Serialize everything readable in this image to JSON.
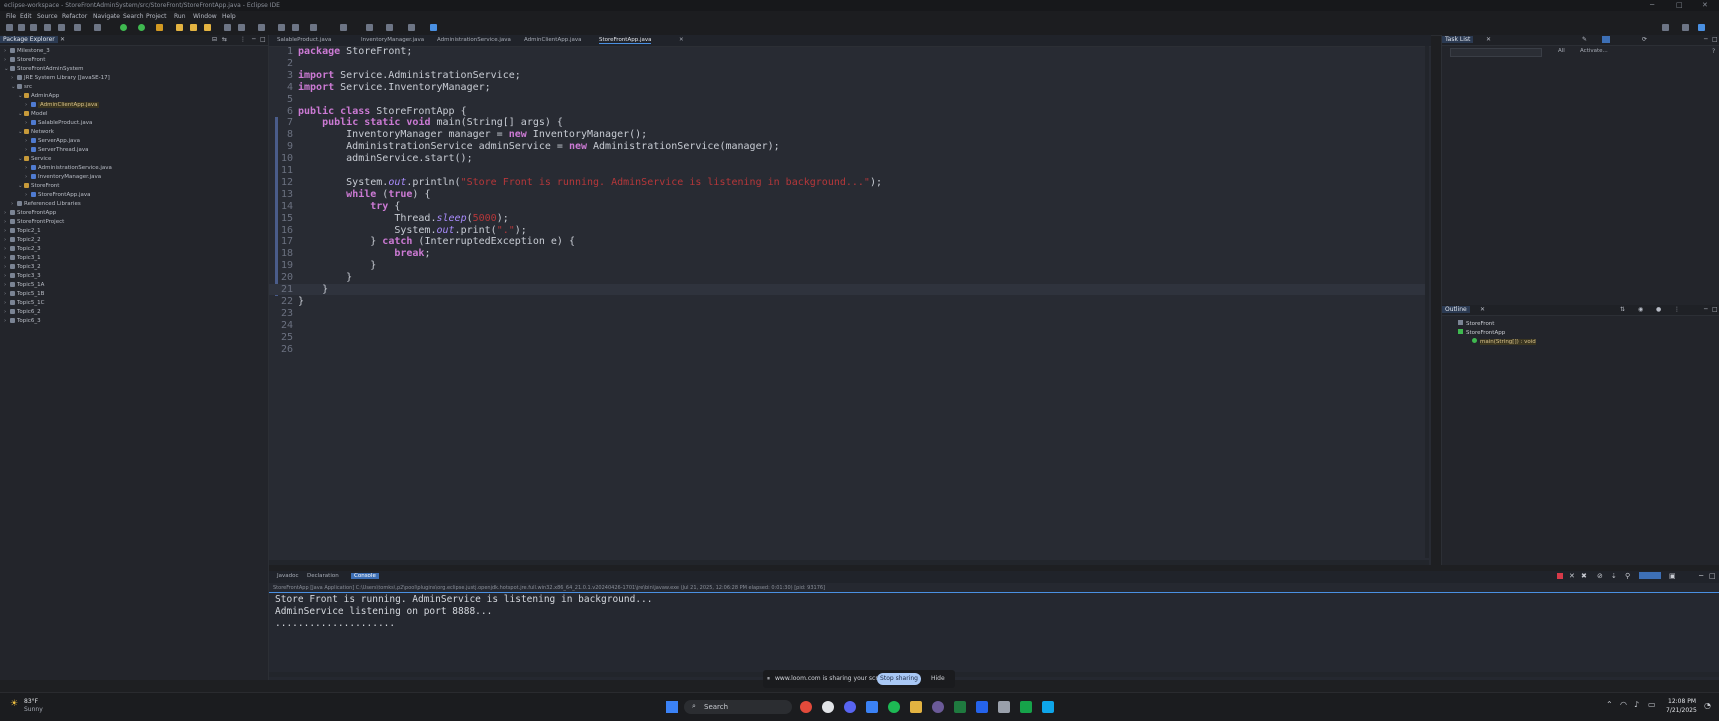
{
  "window": {
    "title": "eclipse-workspace - StoreFrontAdminSystem/src/StoreFront/StoreFrontApp.java - Eclipse IDE"
  },
  "menu": [
    "File",
    "Edit",
    "Source",
    "Refactor",
    "Navigate",
    "Search",
    "Project",
    "Run",
    "Window",
    "Help"
  ],
  "package_explorer": {
    "tab_label": "Package Explorer",
    "items": [
      {
        "label": "Milestone_3",
        "depth": 0,
        "arrow": "›"
      },
      {
        "label": "StoreFront",
        "depth": 0,
        "arrow": "›"
      },
      {
        "label": "StoreFrontAdminSystem",
        "depth": 0,
        "arrow": "⌄"
      },
      {
        "label": "JRE System Library [JavaSE-17]",
        "depth": 1,
        "arrow": "›"
      },
      {
        "label": "src",
        "depth": 1,
        "arrow": "⌄"
      },
      {
        "label": "AdminApp",
        "depth": 2,
        "arrow": "⌄"
      },
      {
        "label": "AdminClientApp.java",
        "depth": 3,
        "arrow": "›",
        "selected": true
      },
      {
        "label": "Model",
        "depth": 2,
        "arrow": "⌄"
      },
      {
        "label": "SalableProduct.java",
        "depth": 3,
        "arrow": "›"
      },
      {
        "label": "Network",
        "depth": 2,
        "arrow": "⌄"
      },
      {
        "label": "ServerApp.java",
        "depth": 3,
        "arrow": "›"
      },
      {
        "label": "ServerThread.java",
        "depth": 3,
        "arrow": "›"
      },
      {
        "label": "Service",
        "depth": 2,
        "arrow": "⌄"
      },
      {
        "label": "AdministrationService.java",
        "depth": 3,
        "arrow": "›"
      },
      {
        "label": "InventoryManager.java",
        "depth": 3,
        "arrow": "›"
      },
      {
        "label": "StoreFront",
        "depth": 2,
        "arrow": "⌄"
      },
      {
        "label": "StoreFrontApp.java",
        "depth": 3,
        "arrow": "›"
      },
      {
        "label": "Referenced Libraries",
        "depth": 1,
        "arrow": "›"
      },
      {
        "label": "StoreFrontApp",
        "depth": 0,
        "arrow": "›"
      },
      {
        "label": "StoreFrontProject",
        "depth": 0,
        "arrow": "›"
      },
      {
        "label": "Topic2_1",
        "depth": 0,
        "arrow": "›"
      },
      {
        "label": "Topic2_2",
        "depth": 0,
        "arrow": "›"
      },
      {
        "label": "Topic2_3",
        "depth": 0,
        "arrow": "›"
      },
      {
        "label": "Topic3_1",
        "depth": 0,
        "arrow": "›"
      },
      {
        "label": "Topic3_2",
        "depth": 0,
        "arrow": "›"
      },
      {
        "label": "Topic3_3",
        "depth": 0,
        "arrow": "›"
      },
      {
        "label": "Topic5_1A",
        "depth": 0,
        "arrow": "›"
      },
      {
        "label": "Topic5_1B",
        "depth": 0,
        "arrow": "›"
      },
      {
        "label": "Topic5_1C",
        "depth": 0,
        "arrow": "›"
      },
      {
        "label": "Topic6_2",
        "depth": 0,
        "arrow": "›"
      },
      {
        "label": "Topic6_3",
        "depth": 0,
        "arrow": "›"
      }
    ]
  },
  "editor": {
    "tabs": [
      "SalableProduct.java",
      "InventoryManager.java",
      "AdministrationService.java",
      "AdminClientApp.java",
      "StoreFrontApp.java"
    ],
    "active_tab": "StoreFrontApp.java",
    "lines": [
      "package StoreFront;",
      "",
      "import Service.AdministrationService;",
      "import Service.InventoryManager;",
      "",
      "public class StoreFrontApp {",
      "    public static void main(String[] args) {",
      "        InventoryManager manager = new InventoryManager();",
      "        AdministrationService adminService = new AdministrationService(manager);",
      "        adminService.start();",
      "",
      "        System.out.println(\"Store Front is running. AdminService is listening in background...\");",
      "        while (true) {",
      "            try {",
      "                Thread.sleep(5000);",
      "                System.out.print(\".\");",
      "            } catch (InterruptedException e) {",
      "                break;",
      "            }",
      "        }",
      "    }",
      "}",
      "",
      "",
      "",
      ""
    ]
  },
  "task_list": {
    "tab_label": "Task List",
    "filter_all": "All",
    "filter_activate": "Activate..."
  },
  "outline": {
    "tab_label": "Outline",
    "items": [
      {
        "label": "StoreFront",
        "depth": 0
      },
      {
        "label": "StoreFrontApp",
        "depth": 0
      },
      {
        "label": "main(String[]) : void",
        "depth": 1
      }
    ]
  },
  "console": {
    "tabs": [
      "Javadoc",
      "Declaration",
      "Console"
    ],
    "active_tab": "Console",
    "path": "StoreFrontApp [Java Application] C:\\Users\\tomks\\.p2\\pool\\plugins\\org.eclipse.justj.openjdk.hotspot.jre.full.win32.x86_64_21.0.1.v20240426-1701\\jre\\bin\\javaw.exe (Jul 21, 2025, 12:06:28 PM elapsed: 0:01:30) [pid: 93176]",
    "output": [
      "Store Front is running. AdminService is listening in background...",
      "AdminService listening on port 8888...",
      "....................."
    ]
  },
  "share_bar": {
    "message": "www.loom.com is sharing your screen.",
    "stop": "Stop sharing",
    "hide": "Hide"
  },
  "taskbar": {
    "weather_temp": "83°F",
    "weather_desc": "Sunny",
    "search": "Search",
    "time": "12:08 PM",
    "date": "7/21/2025"
  },
  "colors": {
    "accent": "#4a90e2",
    "editor_bg": "#282b33",
    "keyword": "#cc7ad4",
    "string": "#b5373a"
  }
}
